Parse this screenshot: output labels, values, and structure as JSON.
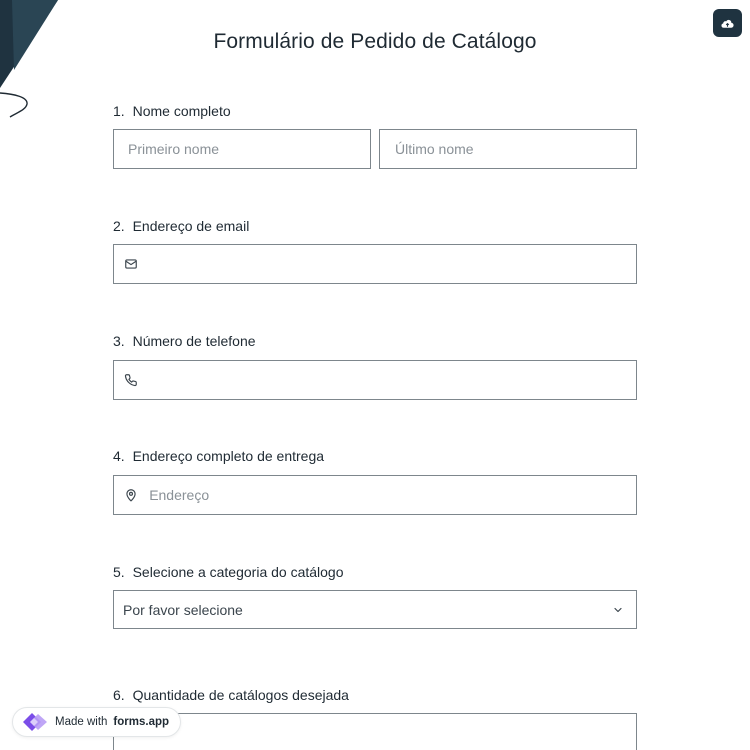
{
  "form": {
    "title": "Formulário de Pedido de Catálogo"
  },
  "questions": [
    {
      "number": "1.",
      "label": "Nome completo"
    },
    {
      "number": "2.",
      "label": "Endereço de email"
    },
    {
      "number": "3.",
      "label": "Número de telefone"
    },
    {
      "number": "4.",
      "label": "Endereço completo de entrega"
    },
    {
      "number": "5.",
      "label": "Selecione a categoria do catálogo"
    },
    {
      "number": "6.",
      "label": "Quantidade de catálogos desejada"
    }
  ],
  "fields": {
    "first_name_placeholder": "Primeiro nome",
    "last_name_placeholder": "Último nome",
    "email_value": "",
    "phone_value": "",
    "address_placeholder": "Endereço",
    "category_selected": "Por favor selecione",
    "quantity_value": ""
  },
  "badge": {
    "prefix": "Made with",
    "brand": "forms.app"
  },
  "icons": {
    "save": "cloud-upload-icon",
    "email": "mail-icon",
    "phone": "phone-icon",
    "address": "map-pin-icon",
    "select": "chevron-down-icon",
    "brand": "forms-app-logo-icon"
  },
  "colors": {
    "accent_dark": "#1f3340",
    "border": "#7d868c",
    "text": "#1f2a33",
    "placeholder": "#8a9197",
    "logo_purple": "#7b4de8"
  }
}
